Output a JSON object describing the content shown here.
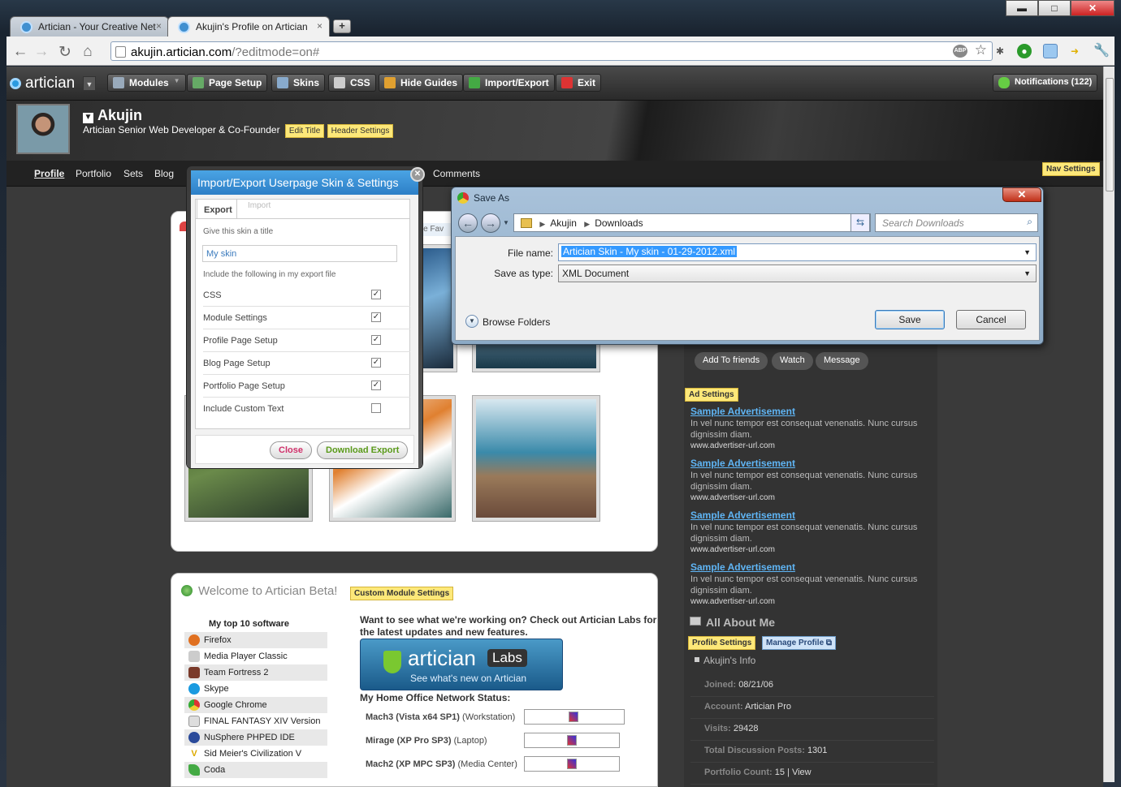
{
  "browser": {
    "tabs": [
      {
        "label": "Artician - Your Creative Net"
      },
      {
        "label": "Akujin's Profile on Artician"
      }
    ],
    "new_tab": "+",
    "url_domain": "akujin.artician.com",
    "url_path": "/?editmode=on#",
    "close": "×"
  },
  "window": {
    "minimize": "▬",
    "maximize": "□",
    "close": "✕"
  },
  "artician": {
    "logo": "artician",
    "menu": [
      "Modules",
      "Page Setup",
      "Skins",
      "CSS",
      "Hide Guides",
      "Import/Export",
      "Exit"
    ],
    "notifications": "Notifications (122)"
  },
  "header": {
    "name": "Akujin",
    "subtitle": "Artician Senior Web Developer & Co-Founder",
    "edit_title": "Edit Title",
    "header_settings": "Header Settings",
    "nav_settings": "Nav Settings"
  },
  "nav": [
    "Profile",
    "Portfolio",
    "Sets",
    "Blog",
    "Comments"
  ],
  "export_dialog": {
    "title": "Import/Export Userpage Skin & Settings",
    "tabs": [
      "Export",
      "Import"
    ],
    "title_label": "Give this skin a title",
    "title_value": "My skin",
    "include_label": "Include the following in my export file",
    "options": [
      {
        "label": "CSS",
        "checked": true
      },
      {
        "label": "Module Settings",
        "checked": true
      },
      {
        "label": "Profile Page Setup",
        "checked": true
      },
      {
        "label": "Blog Page Setup",
        "checked": true
      },
      {
        "label": "Portfolio Page Setup",
        "checked": true
      },
      {
        "label": "Include Custom Text",
        "checked": false
      }
    ],
    "close": "Close",
    "download": "Download Export",
    "peek": "age Fav"
  },
  "save_dialog": {
    "title": "Save As",
    "path": [
      "Akujin",
      "Downloads"
    ],
    "search": "Search Downloads",
    "file_name_label": "File name:",
    "file_name": "Artician Skin - My skin - 01-29-2012.xml",
    "type_label": "Save as type:",
    "type": "XML Document",
    "browse": "Browse Folders",
    "save": "Save",
    "cancel": "Cancel"
  },
  "sidebar": {
    "buttons": [
      "Add To friends",
      "Watch",
      "Message"
    ],
    "ad_settings": "Ad Settings",
    "ads": [
      {
        "title": "Sample Advertisement",
        "desc": "In vel nunc tempor est consequat venenatis. Nunc cursus dignissim diam.",
        "url": "www.advertiser-url.com"
      },
      {
        "title": "Sample Advertisement",
        "desc": "In vel nunc tempor est consequat venenatis. Nunc cursus dignissim diam.",
        "url": "www.advertiser-url.com"
      },
      {
        "title": "Sample Advertisement",
        "desc": "In vel nunc tempor est consequat venenatis. Nunc cursus dignissim diam.",
        "url": "www.advertiser-url.com"
      },
      {
        "title": "Sample Advertisement",
        "desc": "In vel nunc tempor est consequat venenatis. Nunc cursus dignissim diam.",
        "url": "www.advertiser-url.com"
      }
    ],
    "about_title": "All About Me",
    "profile_settings": "Profile Settings",
    "manage_profile": "Manage Profile",
    "info_title": "Akujin's Info",
    "info": [
      {
        "k": "Joined:",
        "v": "08/21/06"
      },
      {
        "k": "Account:",
        "v": "Artician Pro"
      },
      {
        "k": "Visits:",
        "v": "29428"
      },
      {
        "k": "Total Discussion Posts:",
        "v": "1301"
      },
      {
        "k": "Portfolio Count:",
        "v": "15 | View"
      }
    ]
  },
  "welcome": {
    "title": "Welcome to Artician Beta!",
    "custom_settings": "Custom Module Settings",
    "top10_title": "My top 10 software",
    "software": [
      "Firefox",
      "Media Player Classic",
      "Team Fortress 2",
      "Skype",
      "Google Chrome",
      "FINAL FANTASY XIV Version",
      "NuSphere PHPED IDE",
      "Sid Meier's Civilization V",
      "Coda"
    ],
    "labs_text": "Want to see what we're working on? Check out Artician Labs for the latest updates and new features.",
    "labs_logo": "artician",
    "labs_badge": "Labs",
    "labs_sub": "See what's new on Artician",
    "network_title": "My Home Office Network Status:",
    "machines": [
      {
        "name": "Mach3 (Vista x64 SP1)",
        "role": "(Workstation)"
      },
      {
        "name": "Mirage (XP Pro SP3)",
        "role": "(Laptop)"
      },
      {
        "name": "Mach2 (XP MPC SP3)",
        "role": "(Media Center)"
      }
    ]
  },
  "colors": {
    "accent": "#2d7fc7",
    "yellow": "#fde879",
    "link": "#5fb5f5"
  }
}
